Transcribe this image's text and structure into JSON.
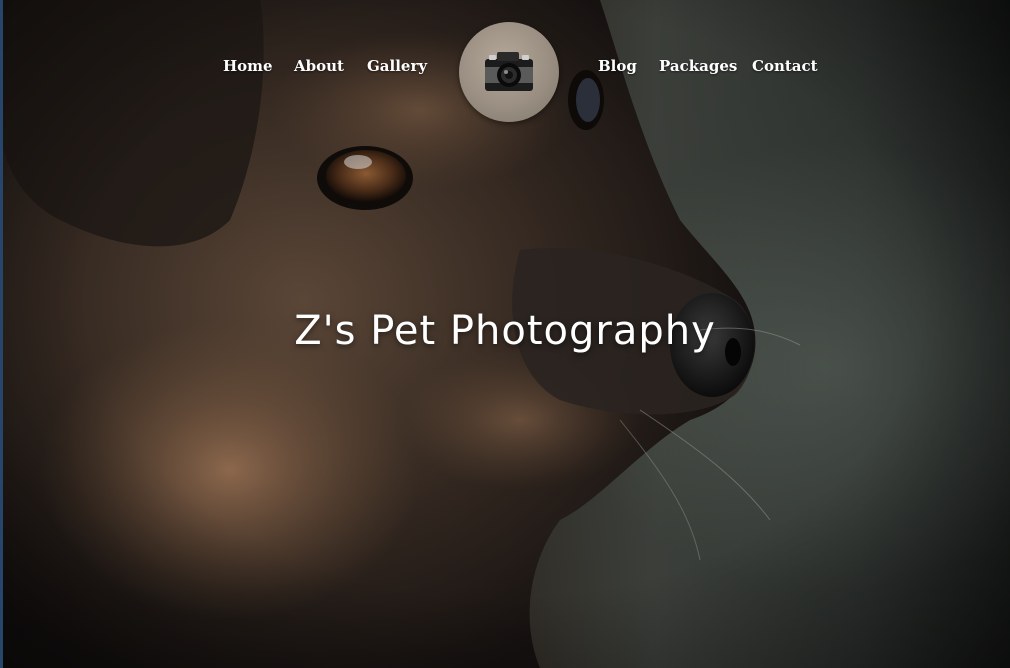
{
  "nav": {
    "left_links": [
      "Home",
      "About",
      "Gallery"
    ],
    "right_links": [
      "Blog",
      "Packages",
      "Contact"
    ]
  },
  "logo": {
    "icon": "camera-icon"
  },
  "hero": {
    "title": "Z's Pet Photography",
    "background_image": "dog-portrait-photo"
  },
  "colors": {
    "nav_text": "#ffffff",
    "title_text": "#ffffff",
    "logo_circle": "#9a8f82"
  }
}
